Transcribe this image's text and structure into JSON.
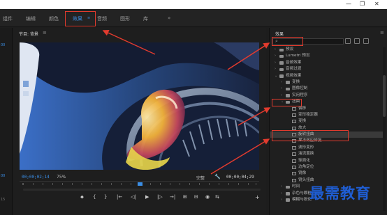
{
  "window": {
    "controls": [
      "—",
      "❐",
      "✕"
    ]
  },
  "workspaces": {
    "tabs": [
      "组件",
      "编辑",
      "颜色",
      "效果",
      "音频",
      "图形",
      "库"
    ],
    "active_index": 3,
    "more": "»",
    "menu_icon": "≡"
  },
  "left_strip": {
    "labels": [
      "00",
      "00",
      "15"
    ]
  },
  "program": {
    "title": "节目: 背景",
    "menu_icon": "≡",
    "timecode_current": "00;00;02;14",
    "zoom": "75%",
    "quality": "完整",
    "timecode_duration": "00;00;04;29",
    "controls": [
      "⬥",
      "{",
      "}",
      "|←",
      "◁|",
      "▶",
      "|▷",
      "→|",
      "⊞",
      "⊟",
      "◉",
      "⇆"
    ],
    "add_button": "+"
  },
  "effects": {
    "title": "效果",
    "menu_icon": "≡",
    "search_placeholder": "",
    "tree": [
      {
        "label": "预设",
        "type": "folder",
        "level": 0,
        "expanded": false
      },
      {
        "label": "Lumetri 预设",
        "type": "folder",
        "level": 0,
        "expanded": false
      },
      {
        "label": "音频效果",
        "type": "folder",
        "level": 0,
        "expanded": false
      },
      {
        "label": "音频过渡",
        "type": "folder",
        "level": 0,
        "expanded": false
      },
      {
        "label": "视频效果",
        "type": "folder",
        "level": 0,
        "expanded": true
      },
      {
        "label": "变换",
        "type": "folder",
        "level": 1,
        "expanded": false
      },
      {
        "label": "图像控制",
        "type": "folder",
        "level": 1,
        "expanded": false
      },
      {
        "label": "实用程序",
        "type": "folder",
        "level": 1,
        "expanded": false
      },
      {
        "label": "扭曲",
        "type": "folder",
        "level": 1,
        "expanded": true
      },
      {
        "label": "偏移",
        "type": "effect",
        "level": 2
      },
      {
        "label": "变形稳定器",
        "type": "effect",
        "level": 2
      },
      {
        "label": "变换",
        "type": "effect",
        "level": 2
      },
      {
        "label": "放大",
        "type": "effect",
        "level": 2
      },
      {
        "label": "旋转扭曲",
        "type": "effect",
        "level": 2,
        "selected": true
      },
      {
        "label": "果冻效应修复",
        "type": "effect",
        "level": 2
      },
      {
        "label": "波形变形",
        "type": "effect",
        "level": 2
      },
      {
        "label": "湍流置换",
        "type": "effect",
        "level": 2
      },
      {
        "label": "球面化",
        "type": "effect",
        "level": 2
      },
      {
        "label": "边角定位",
        "type": "effect",
        "level": 2
      },
      {
        "label": "镜像",
        "type": "effect",
        "level": 2
      },
      {
        "label": "镜头扭曲",
        "type": "effect",
        "level": 2
      },
      {
        "label": "时间",
        "type": "folder",
        "level": 1,
        "expanded": false
      },
      {
        "label": "杂色与颗粒",
        "type": "folder",
        "level": 1,
        "expanded": false
      },
      {
        "label": "模糊与锐化",
        "type": "folder",
        "level": 1,
        "expanded": false
      }
    ]
  },
  "watermark": {
    "text": "最需教育"
  },
  "colors": {
    "accent": "#3b8ee5",
    "annotation": "#e23b2e",
    "watermark": "#1f5dd2"
  }
}
